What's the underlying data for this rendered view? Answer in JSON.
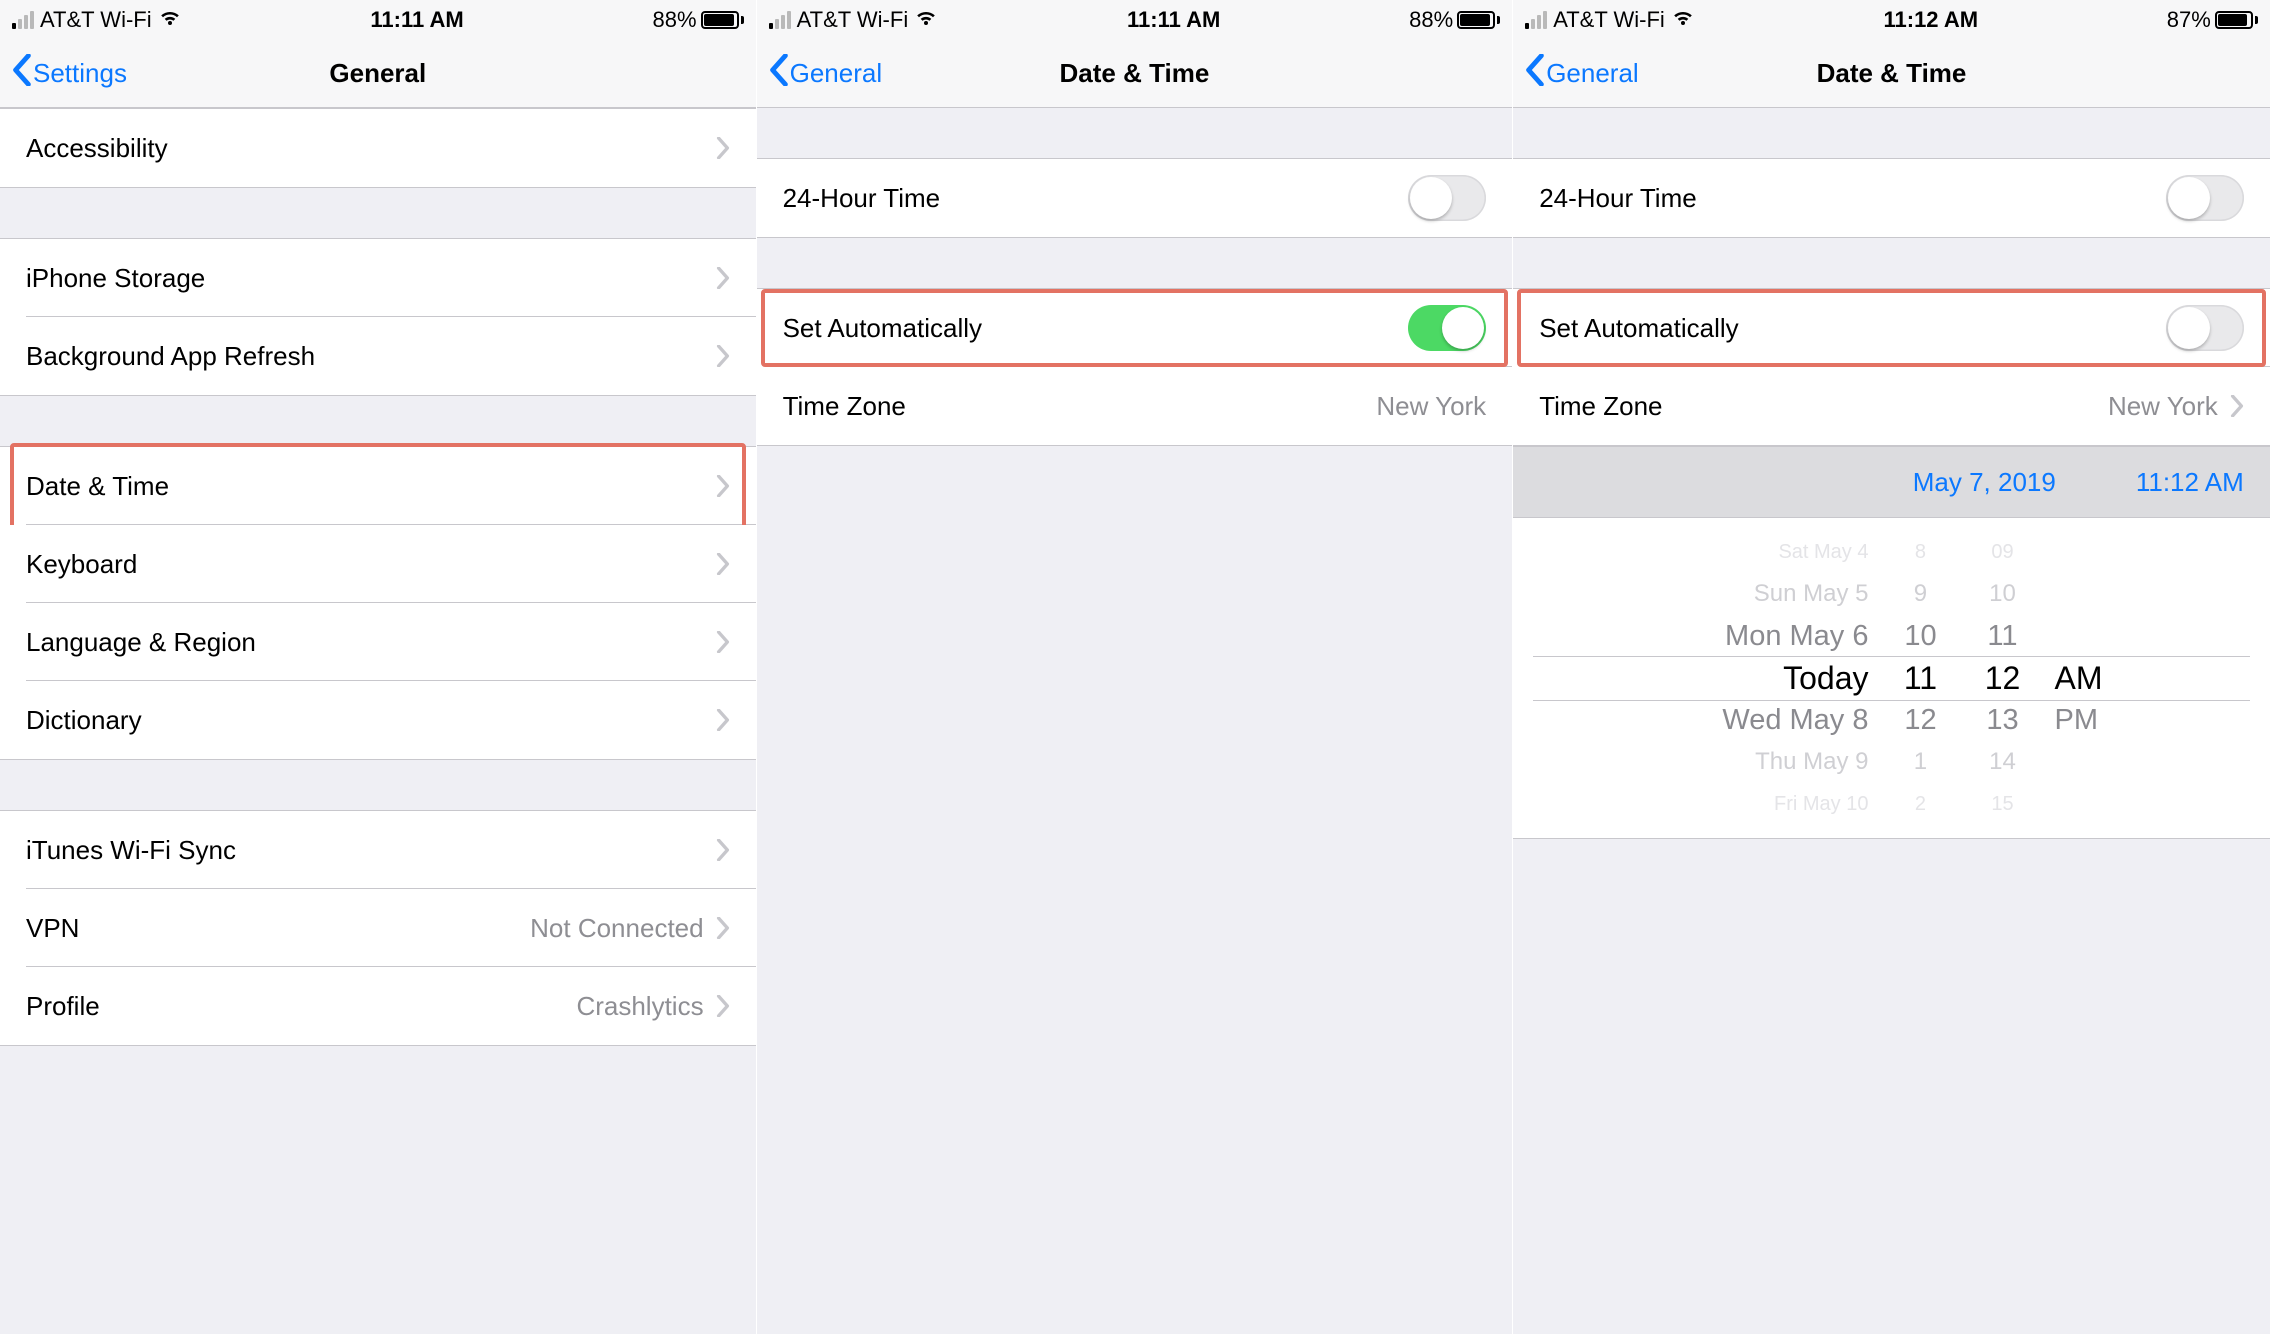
{
  "highlight_color": "#e37263",
  "screen1": {
    "status": {
      "carrier": "AT&T Wi-Fi",
      "time": "11:11 AM",
      "battery_pct": "88%",
      "battery_fill": 88
    },
    "nav": {
      "back": "Settings",
      "title": "General"
    },
    "rows": {
      "accessibility": "Accessibility",
      "iphone_storage": "iPhone Storage",
      "background_refresh": "Background App Refresh",
      "date_time": "Date & Time",
      "keyboard": "Keyboard",
      "language_region": "Language & Region",
      "dictionary": "Dictionary",
      "itunes_wifi_sync": "iTunes Wi-Fi Sync",
      "vpn": "VPN",
      "vpn_value": "Not Connected",
      "profile": "Profile",
      "profile_value": "Crashlytics"
    }
  },
  "screen2": {
    "status": {
      "carrier": "AT&T Wi-Fi",
      "time": "11:11 AM",
      "battery_pct": "88%",
      "battery_fill": 88
    },
    "nav": {
      "back": "General",
      "title": "Date & Time"
    },
    "rows": {
      "twenty_four_hour": "24-Hour Time",
      "set_automatically": "Set Automatically",
      "time_zone": "Time Zone",
      "time_zone_value": "New York"
    },
    "toggles": {
      "twenty_four_hour": false,
      "set_automatically": true
    }
  },
  "screen3": {
    "status": {
      "carrier": "AT&T Wi-Fi",
      "time": "11:12 AM",
      "battery_pct": "87%",
      "battery_fill": 87
    },
    "nav": {
      "back": "General",
      "title": "Date & Time"
    },
    "rows": {
      "twenty_four_hour": "24-Hour Time",
      "set_automatically": "Set Automatically",
      "time_zone": "Time Zone",
      "time_zone_value": "New York"
    },
    "toggles": {
      "twenty_four_hour": false,
      "set_automatically": false
    },
    "date_header": {
      "date": "May 7, 2019",
      "time": "11:12 AM"
    },
    "picker": {
      "dates": [
        "Sat May 4",
        "Sun May 5",
        "Mon May 6",
        "Today",
        "Wed May 8",
        "Thu May 9",
        "Fri May 10"
      ],
      "hours": [
        "8",
        "9",
        "10",
        "11",
        "12",
        "1",
        "2"
      ],
      "minutes": [
        "09",
        "10",
        "11",
        "12",
        "13",
        "14",
        "15"
      ],
      "ampm": [
        "AM",
        "PM"
      ]
    }
  }
}
